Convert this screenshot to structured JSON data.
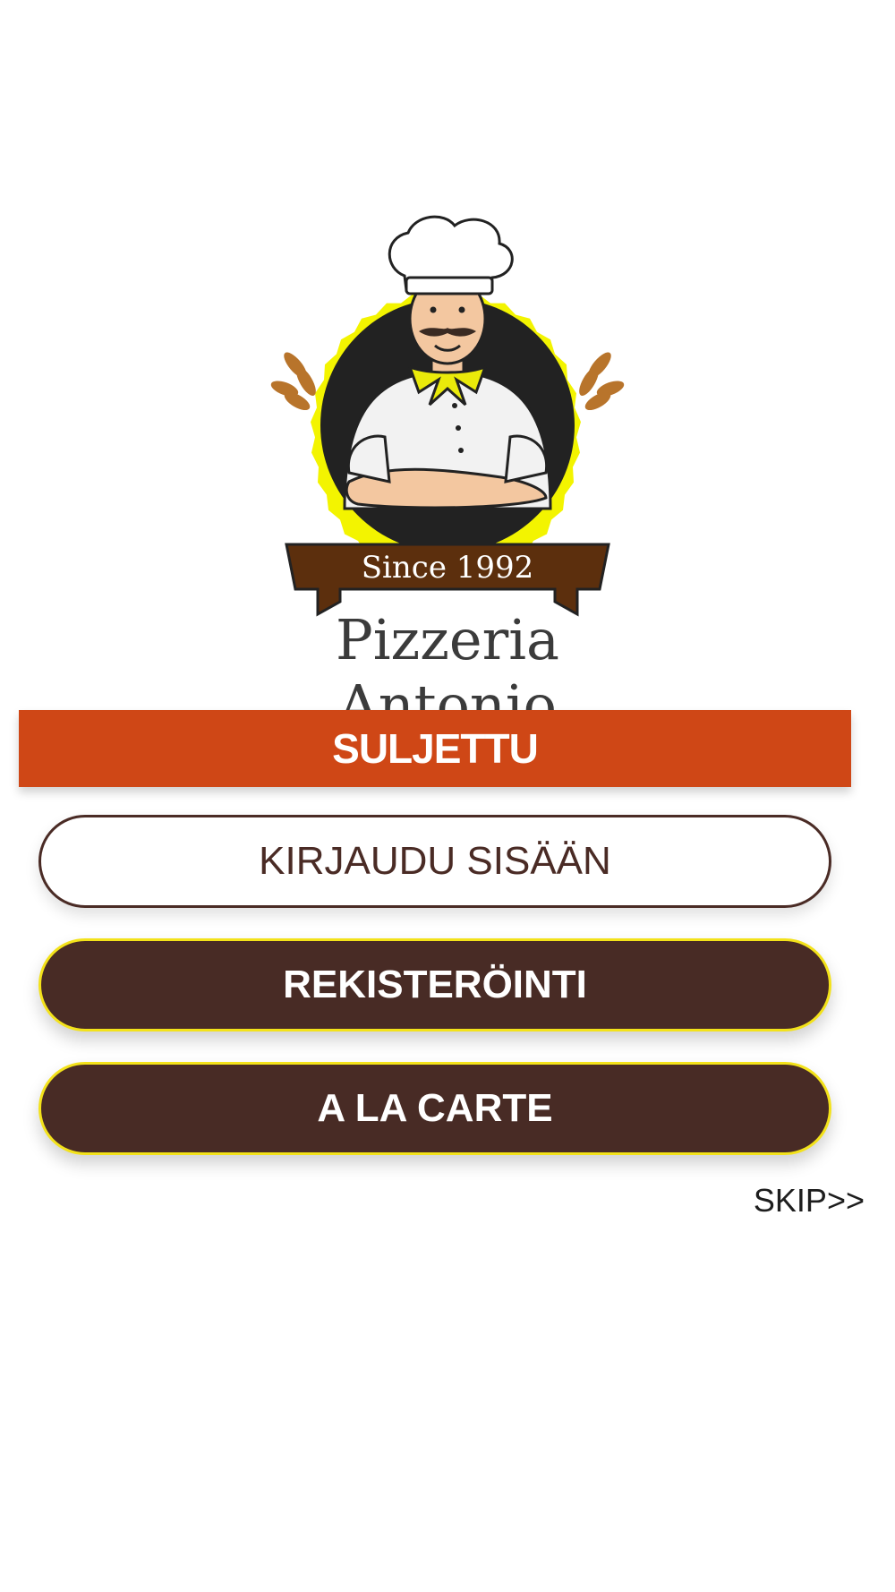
{
  "logo": {
    "badge_text": "Since 1992",
    "brand_name": "Pizzeria Antonio",
    "colors": {
      "ring": "#f3f400",
      "disk": "#222222",
      "ribbon": "#5c2f0d",
      "scarf": "#eaea0a",
      "wheat": "#b8742b"
    }
  },
  "status": {
    "label": "SULJETTU",
    "color": "#cf4716"
  },
  "buttons": {
    "login_label": "KIRJAUDU SISÄÄN",
    "register_label": "REKISTERÖINTI",
    "alacarte_label": "A LA CARTE"
  },
  "skip": {
    "label": "SKIP>>"
  },
  "colors": {
    "primary_brown": "#482b25",
    "accent_yellow": "#f3e21a"
  }
}
